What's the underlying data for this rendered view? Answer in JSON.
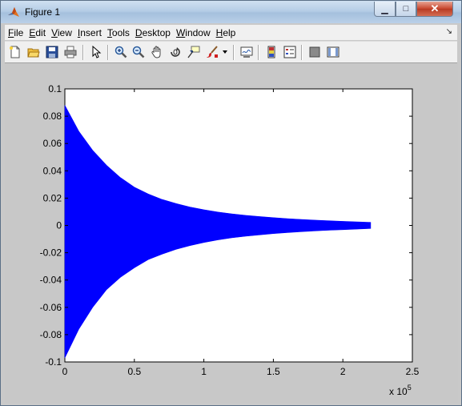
{
  "window": {
    "title": "Figure 1",
    "minimize_glyph": "▁",
    "maximize_glyph": "□",
    "close_glyph": "✕"
  },
  "menu": {
    "items": [
      {
        "label": "File",
        "mnemonic": "F",
        "rest": "ile"
      },
      {
        "label": "Edit",
        "mnemonic": "E",
        "rest": "dit"
      },
      {
        "label": "View",
        "mnemonic": "V",
        "rest": "iew"
      },
      {
        "label": "Insert",
        "mnemonic": "I",
        "rest": "nsert"
      },
      {
        "label": "Tools",
        "mnemonic": "T",
        "rest": "ools"
      },
      {
        "label": "Desktop",
        "mnemonic": "D",
        "rest": "esktop"
      },
      {
        "label": "Window",
        "mnemonic": "W",
        "rest": "indow"
      },
      {
        "label": "Help",
        "mnemonic": "H",
        "rest": "elp"
      }
    ],
    "overflow_arrow": "↘"
  },
  "toolbar": {
    "icons": [
      "new-figure-icon",
      "open-file-icon",
      "save-icon",
      "print-icon",
      "edit-plot-icon",
      "zoom-in-icon",
      "zoom-out-icon",
      "pan-icon",
      "rotate-3d-icon",
      "data-cursor-icon",
      "brush-icon",
      "brush-dropdown-icon",
      "link-plot-icon",
      "insert-colorbar-icon",
      "insert-legend-icon",
      "hide-plot-tools-icon",
      "show-plot-tools-icon"
    ]
  },
  "chart_data": {
    "type": "line",
    "title": "",
    "xlabel": "",
    "ylabel": "",
    "x_multiplier_label": "x 10",
    "x_multiplier_exponent": "5",
    "xlim": [
      0,
      2.5
    ],
    "ylim": [
      -0.1,
      0.1
    ],
    "xticks": [
      "0",
      "0.5",
      "1",
      "1.5",
      "2",
      "2.5"
    ],
    "yticks": [
      "0.1",
      "0.08",
      "0.06",
      "0.04",
      "0.02",
      "0",
      "-0.02",
      "-0.04",
      "-0.06",
      "-0.08",
      "-0.1"
    ],
    "grid": false,
    "legend": "none",
    "series": [
      {
        "color": "#0000ff",
        "description_envelope_x": [
          0,
          0.1,
          0.2,
          0.3,
          0.4,
          0.5,
          0.6,
          0.7,
          0.8,
          0.9,
          1.0,
          1.1,
          1.2,
          1.3,
          1.4,
          1.5,
          1.6,
          1.7,
          1.8,
          1.9,
          2.0,
          2.1,
          2.2
        ],
        "upper_envelope": [
          0.088,
          0.069,
          0.055,
          0.044,
          0.035,
          0.028,
          0.023,
          0.019,
          0.016,
          0.0135,
          0.0115,
          0.0098,
          0.0085,
          0.0074,
          0.0065,
          0.0057,
          0.005,
          0.0044,
          0.0039,
          0.0034,
          0.003,
          0.0026,
          0.0022
        ],
        "lower_envelope": [
          -0.097,
          -0.076,
          -0.06,
          -0.047,
          -0.038,
          -0.031,
          -0.025,
          -0.021,
          -0.0175,
          -0.0148,
          -0.0125,
          -0.0106,
          -0.0091,
          -0.0079,
          -0.0069,
          -0.006,
          -0.0052,
          -0.0046,
          -0.004,
          -0.0035,
          -0.0031,
          -0.0027,
          -0.0022
        ]
      }
    ]
  }
}
